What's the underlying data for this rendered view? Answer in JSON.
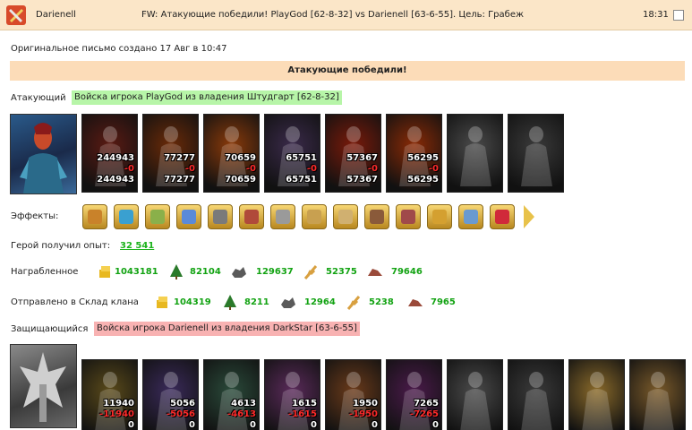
{
  "header": {
    "sender": "Darienell",
    "subject": "FW: Атакующие победили! PlayGod [62-8-32] vs Darienell [63-6-55]. Цель: Грабеж",
    "time": "18:31"
  },
  "created": "Оригинальное письмо создано 17 Авг в 10:47",
  "banner": "Атакующие победили!",
  "attacker": {
    "label": "Атакующий",
    "army": "Войска игрока PlayGod из владения Штудгарт [62-8-32]",
    "units": [
      {
        "count": "244943",
        "loss": "-0",
        "left": "244943",
        "color": "#5a1a12"
      },
      {
        "count": "77277",
        "loss": "-0",
        "left": "77277",
        "color": "#6a2a08"
      },
      {
        "count": "70659",
        "loss": "-0",
        "left": "70659",
        "color": "#8a3a0a"
      },
      {
        "count": "65751",
        "loss": "-0",
        "left": "65751",
        "color": "#3a2a4a"
      },
      {
        "count": "57367",
        "loss": "-0",
        "left": "57367",
        "color": "#7a1a0a"
      },
      {
        "count": "56295",
        "loss": "-0",
        "left": "56295",
        "color": "#8a2a06"
      },
      {
        "count": "",
        "loss": "",
        "left": "",
        "color": "#4a4a4a"
      },
      {
        "count": "",
        "loss": "",
        "left": "",
        "color": "#3a3a3a"
      }
    ]
  },
  "effects": {
    "label": "Эффекты:",
    "icons": [
      "fist-icon",
      "sword-icon",
      "hand-icon",
      "magic-hand-icon",
      "helmet-icon",
      "boots-icon",
      "armor-icon",
      "scroll-icon",
      "scroll2-icon",
      "blade-icon",
      "shield-icon",
      "horn-icon",
      "potion-icon",
      "heart-icon"
    ],
    "colors": [
      "#c9822a",
      "#3aa0d0",
      "#8ab04a",
      "#5a8ad8",
      "#7a7a7a",
      "#b04a3a",
      "#9a9a9a",
      "#c8a050",
      "#d0b070",
      "#8a5a3a",
      "#a04a4a",
      "#d4a030",
      "#6a9ad0",
      "#d02a3a"
    ]
  },
  "xp": {
    "label": "Герой получил опыт:",
    "value": "32 541"
  },
  "plunder": {
    "label": "Награбленное",
    "values": [
      "1043181",
      "82104",
      "129637",
      "52375",
      "79646"
    ]
  },
  "clan": {
    "label": "Отправлено в Склад клана",
    "values": [
      "104319",
      "8211",
      "12964",
      "5238",
      "7965"
    ]
  },
  "defender": {
    "label": "Защищающийся",
    "army": "Войска игрока Darienell из владения DarkStar [63-6-55]",
    "units": [
      {
        "count": "11940",
        "loss": "-11940",
        "left": "0",
        "color": "#5a4a1a"
      },
      {
        "count": "5056",
        "loss": "-5056",
        "left": "0",
        "color": "#3a2a5a"
      },
      {
        "count": "4613",
        "loss": "-4613",
        "left": "0",
        "color": "#2a4a3a"
      },
      {
        "count": "1615",
        "loss": "-1615",
        "left": "0",
        "color": "#5a2a5a"
      },
      {
        "count": "1950",
        "loss": "-1950",
        "left": "0",
        "color": "#6a3a1a"
      },
      {
        "count": "7265",
        "loss": "-7265",
        "left": "0",
        "color": "#4a1a4a"
      },
      {
        "count": "",
        "loss": "",
        "left": "",
        "color": "#4a4a4a"
      },
      {
        "count": "",
        "loss": "",
        "left": "",
        "color": "#3a3a3a"
      },
      {
        "count": "",
        "loss": "",
        "left": "",
        "color": "#8a6a2a"
      },
      {
        "count": "",
        "loss": "",
        "left": "",
        "color": "#7a5a2a"
      }
    ]
  },
  "resource_icons": [
    "gold-icon",
    "wood-icon",
    "ore-icon",
    "grain-icon",
    "stone-icon"
  ]
}
